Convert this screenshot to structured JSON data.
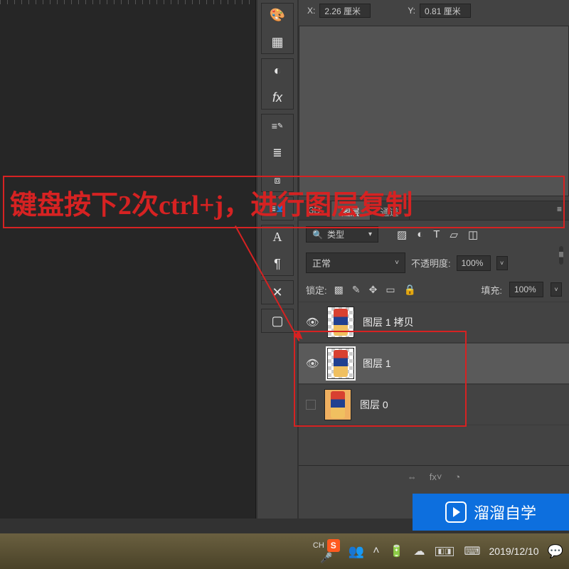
{
  "properties": {
    "x_label": "X:",
    "x_value": "2.26 厘米",
    "y_label": "Y:",
    "y_value": "0.81 厘米"
  },
  "panel_tabs": {
    "t3d": "3D",
    "layers": "图层",
    "channels": "通道"
  },
  "filter": {
    "type_label": "类型"
  },
  "blend": {
    "mode": "正常",
    "opacity_label": "不透明度:",
    "opacity_value": "100%"
  },
  "lock": {
    "label": "锁定:",
    "fill_label": "填充:",
    "fill_value": "100%"
  },
  "layers": [
    {
      "name": "图层 1 拷贝",
      "visible": true,
      "selected": false
    },
    {
      "name": "图层 1",
      "visible": true,
      "selected": true
    },
    {
      "name": "图层 0",
      "visible": false,
      "selected": false
    }
  ],
  "footer_icons": {
    "link": "⇔",
    "fx": "fx˅"
  },
  "annotation": {
    "pre": "键盘按下",
    "count": "2",
    "mid": "次",
    "key": "ctrl+j",
    "post": "，进行图层复制"
  },
  "taskbar": {
    "ime_lang": "CH",
    "ime_s": "S",
    "mic": "🎤",
    "date": "2019/12/10"
  },
  "watermark": "溜溜自学"
}
